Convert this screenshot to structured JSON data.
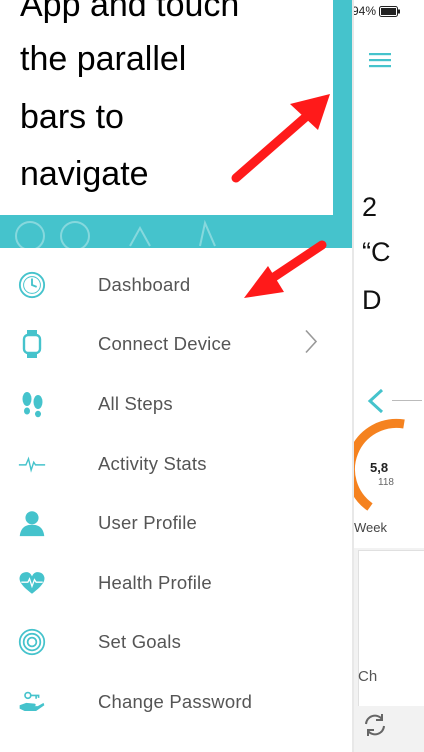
{
  "status": {
    "battery": "94%"
  },
  "callout": {
    "lines": [
      "App and touch",
      "the parallel",
      "bars to",
      "navigate"
    ]
  },
  "instruction": {
    "lines": [
      "2",
      "“C",
      "D"
    ]
  },
  "menu": {
    "items": [
      {
        "label": "Dashboard",
        "icon": "clock-icon"
      },
      {
        "label": "Connect Device",
        "icon": "watch-icon"
      },
      {
        "label": "All Steps",
        "icon": "footprints-icon"
      },
      {
        "label": "Activity Stats",
        "icon": "pulse-line-icon"
      },
      {
        "label": "User Profile",
        "icon": "user-icon"
      },
      {
        "label": "Health Profile",
        "icon": "heart-pulse-icon"
      },
      {
        "label": "Set Goals",
        "icon": "target-icon"
      },
      {
        "label": "Change Password",
        "icon": "key-hand-icon"
      }
    ]
  },
  "dashboard_peek": {
    "steps_value": "5,8",
    "steps_sub": "118",
    "week_label": "Week",
    "card_label": "Ch"
  },
  "colors": {
    "accent": "#45c3cc",
    "ring": "#f5821f",
    "arrow": "#ff1a1a",
    "icon": "#45c3cc"
  }
}
